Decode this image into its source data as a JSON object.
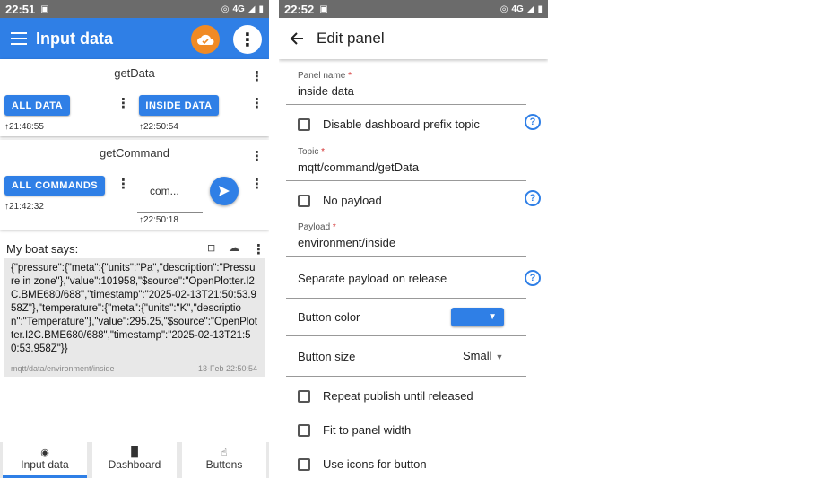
{
  "left": {
    "status": {
      "time": "22:51",
      "network": "4G"
    },
    "appbar": {
      "title": "Input data"
    },
    "cards": {
      "get_data": {
        "title": "getData",
        "buttons": [
          {
            "label": "ALL DATA",
            "time": "↑21:48:55"
          },
          {
            "label": "INSIDE DATA",
            "time": "↑22:50:54"
          }
        ]
      },
      "get_command": {
        "title": "getCommand",
        "button": {
          "label": "ALL COMMANDS",
          "time": "↑21:42:32"
        },
        "text_input": {
          "value": "com...",
          "time": "↑22:50:18"
        }
      },
      "message": {
        "title": "My boat says:",
        "body": "{\"pressure\":{\"meta\":{\"units\":\"Pa\",\"description\":\"Pressure in zone\"},\"value\":101958,\"$source\":\"OpenPlotter.I2C.BME680/688\",\"timestamp\":\"2025-02-13T21:50:53.958Z\"},\"temperature\":{\"meta\":{\"units\":\"K\",\"description\":\"Temperature\"},\"value\":295.25,\"$source\":\"OpenPlotter.I2C.BME680/688\",\"timestamp\":\"2025-02-13T21:50:53.958Z\"}}",
        "topic": "mqtt/data/environment/inside",
        "timestamp": "13-Feb 22:50:54"
      }
    },
    "bottom_nav": [
      {
        "label": "Input data",
        "icon": "eye-icon"
      },
      {
        "label": "Dashboard",
        "icon": "bar-chart-icon"
      },
      {
        "label": "Buttons",
        "icon": "touch-icon"
      }
    ]
  },
  "right": {
    "status": {
      "time": "22:52",
      "network": "4G"
    },
    "appbar": {
      "title": "Edit panel"
    },
    "form": {
      "panel_name": {
        "label": "Panel name",
        "value": "inside data"
      },
      "disable_prefix": {
        "label": "Disable dashboard prefix topic"
      },
      "topic": {
        "label": "Topic",
        "value": "mqtt/command/getData"
      },
      "no_payload": {
        "label": "No payload"
      },
      "payload": {
        "label": "Payload",
        "value": "environment/inside"
      },
      "separate_payload": {
        "label": "Separate payload on release"
      },
      "button_color": {
        "label": "Button color",
        "value": "#2f7fe6"
      },
      "button_size": {
        "label": "Button size",
        "value": "Small"
      },
      "repeat_publish": {
        "label": "Repeat publish until released"
      },
      "fit_width": {
        "label": "Fit to panel width"
      },
      "use_icons": {
        "label": "Use icons for button"
      }
    }
  },
  "colors": {
    "accent": "#2f7fe6",
    "cloud": "#f08a24",
    "statusbar": "#6b6b6b"
  }
}
